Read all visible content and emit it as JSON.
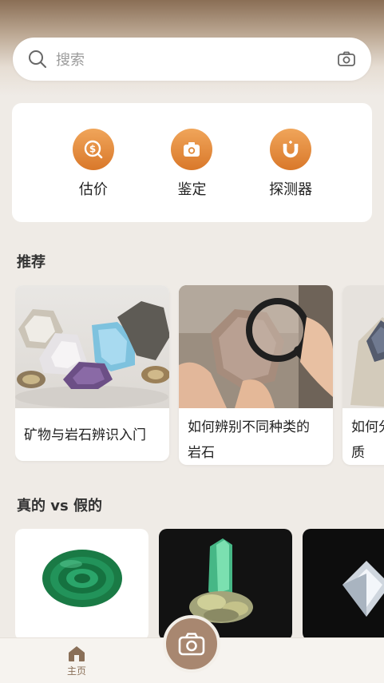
{
  "search": {
    "placeholder": "搜索"
  },
  "tools": [
    {
      "label": "估价",
      "icon": "dollar-search-icon"
    },
    {
      "label": "鉴定",
      "icon": "camera-icon"
    },
    {
      "label": "探测器",
      "icon": "magnet-icon"
    }
  ],
  "sections": {
    "recommend_title": "推荐",
    "real_vs_fake_title": "真的 vs 假的"
  },
  "recommend_cards": [
    {
      "title": "矿物与岩石辨识入门"
    },
    {
      "title_line1": "如何辨别不同种类的",
      "title_line2": "岩石"
    },
    {
      "title_line1": "如何分",
      "title_line2": "质"
    }
  ],
  "vs_cards": [
    {
      "name": "malachite-image"
    },
    {
      "name": "emerald-crystal-image"
    },
    {
      "name": "diamond-image"
    }
  ],
  "bottom_nav": {
    "home_label": "主页"
  },
  "colors": {
    "accent": "#d9782a",
    "brand_brown": "#a88770",
    "background": "#efebe6"
  }
}
